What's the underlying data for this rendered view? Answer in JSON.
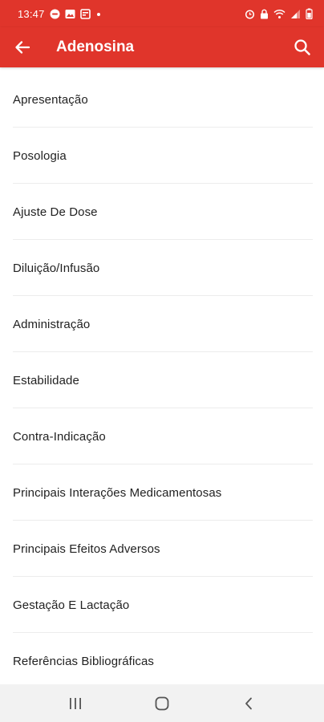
{
  "status_bar": {
    "time": "13:47",
    "left_icons": [
      "chat-notification-icon",
      "image-notification-icon",
      "calendar-notification-icon",
      "dot-icon"
    ],
    "right_icons": [
      "alarm-icon",
      "lock-icon",
      "wifi-icon",
      "signal-icon",
      "battery-icon"
    ]
  },
  "app_bar": {
    "title": "Adenosina",
    "back_icon": "arrow-left-icon",
    "search_icon": "search-icon"
  },
  "colors": {
    "primary": "#e0352b",
    "text": "#222222",
    "divider": "#ececec",
    "navbar_bg": "#f2f2f2"
  },
  "sections": [
    {
      "label": "Apresentação"
    },
    {
      "label": "Posologia"
    },
    {
      "label": "Ajuste De Dose"
    },
    {
      "label": "Diluição/Infusão"
    },
    {
      "label": "Administração"
    },
    {
      "label": "Estabilidade"
    },
    {
      "label": "Contra-Indicação"
    },
    {
      "label": "Principais Interações Medicamentosas"
    },
    {
      "label": "Principais Efeitos Adversos"
    },
    {
      "label": "Gestação E Lactação"
    },
    {
      "label": "Referências Bibliográficas"
    }
  ],
  "nav_bar": {
    "buttons": [
      "recent-apps-icon",
      "home-icon",
      "back-icon"
    ]
  }
}
